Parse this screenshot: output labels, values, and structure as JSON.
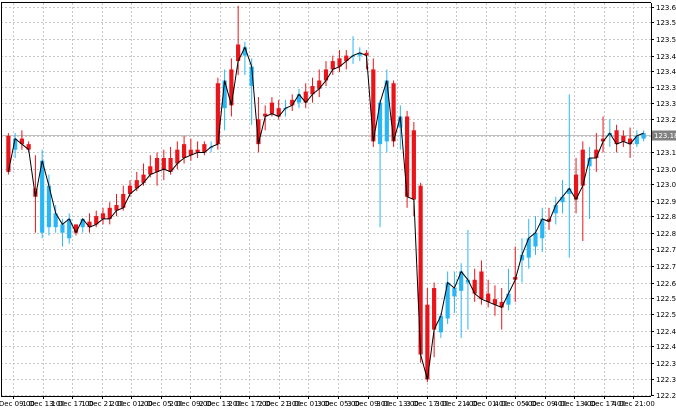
{
  "chart_data": {
    "type": "candlestick",
    "title": "",
    "xlabel": "",
    "ylabel": "",
    "y_range": [
      122.24,
      123.66
    ],
    "grid": true,
    "up_color": "#29b6f6",
    "down_color": "#e8151b",
    "line_color": "#000000",
    "axis_color": "#000000",
    "grid_color": "#c8c8c8",
    "price_line_color": "#c0c0c0",
    "last_label_bg": "#808080",
    "y_ticks": [
      "123.645",
      "123.590",
      "123.530",
      "123.470",
      "123.415",
      "123.355",
      "123.300",
      "123.240",
      "123.180",
      "123.120",
      "123.060",
      "123.005",
      "122.945",
      "122.890",
      "122.830",
      "122.770",
      "122.710",
      "122.650",
      "122.595",
      "122.535",
      "122.475",
      "122.420",
      "122.360",
      "122.300",
      "122.245"
    ],
    "x_ticks": [
      "1 Dec 09:00",
      "1 Dec 13:00",
      "1 Dec 17:00",
      "1 Dec 21:00",
      "2 Dec 01:00",
      "2 Dec 05:00",
      "2 Dec 09:00",
      "2 Dec 13:00",
      "2 Dec 17:00",
      "2 Dec 21:00",
      "3 Dec 01:00",
      "3 Dec 05:00",
      "3 Dec 09:00",
      "3 Dec 13:00",
      "3 Dec 17:00",
      "3 Dec 21:00",
      "4 Dec 01:00",
      "4 Dec 05:00",
      "4 Dec 09:00",
      "4 Dec 13:00",
      "4 Dec 17:00",
      "4 Dec 21:00"
    ],
    "last_price": "123.184",
    "last_price_value": 123.184,
    "ohlc": [
      {
        "o": 123.18,
        "h": 123.19,
        "l": 123.04,
        "c": 123.05
      },
      {
        "o": 123.13,
        "h": 123.19,
        "l": 123.1,
        "c": 123.17
      },
      {
        "o": 123.17,
        "h": 123.2,
        "l": 123.13,
        "c": 123.15
      },
      {
        "o": 123.15,
        "h": 123.16,
        "l": 123.12,
        "c": 123.13
      },
      {
        "o": 122.99,
        "h": 123.11,
        "l": 122.83,
        "c": 122.96
      },
      {
        "o": 122.83,
        "h": 123.13,
        "l": 122.81,
        "c": 123.09
      },
      {
        "o": 122.85,
        "h": 123.04,
        "l": 122.82,
        "c": 123.0
      },
      {
        "o": 122.85,
        "h": 122.93,
        "l": 122.83,
        "c": 122.9
      },
      {
        "o": 122.83,
        "h": 122.88,
        "l": 122.78,
        "c": 122.86
      },
      {
        "o": 122.81,
        "h": 122.9,
        "l": 122.79,
        "c": 122.88
      },
      {
        "o": 122.86,
        "h": 122.86,
        "l": 122.82,
        "c": 122.83
      },
      {
        "o": 122.85,
        "h": 122.88,
        "l": 122.83,
        "c": 122.88
      },
      {
        "o": 122.87,
        "h": 122.9,
        "l": 122.83,
        "c": 122.85
      },
      {
        "o": 122.89,
        "h": 122.91,
        "l": 122.85,
        "c": 122.86
      },
      {
        "o": 122.9,
        "h": 122.92,
        "l": 122.86,
        "c": 122.88
      },
      {
        "o": 122.92,
        "h": 122.94,
        "l": 122.86,
        "c": 122.88
      },
      {
        "o": 122.93,
        "h": 122.97,
        "l": 122.89,
        "c": 122.91
      },
      {
        "o": 122.97,
        "h": 123.0,
        "l": 122.91,
        "c": 122.92
      },
      {
        "o": 123.0,
        "h": 123.02,
        "l": 122.96,
        "c": 122.97
      },
      {
        "o": 123.02,
        "h": 123.05,
        "l": 122.98,
        "c": 122.99
      },
      {
        "o": 123.04,
        "h": 123.08,
        "l": 123.0,
        "c": 123.01
      },
      {
        "o": 123.07,
        "h": 123.11,
        "l": 123.03,
        "c": 123.04
      },
      {
        "o": 123.1,
        "h": 123.12,
        "l": 123.0,
        "c": 123.05
      },
      {
        "o": 123.1,
        "h": 123.13,
        "l": 123.02,
        "c": 123.06
      },
      {
        "o": 123.1,
        "h": 123.14,
        "l": 123.04,
        "c": 123.05
      },
      {
        "o": 123.13,
        "h": 123.16,
        "l": 123.06,
        "c": 123.08
      },
      {
        "o": 123.15,
        "h": 123.18,
        "l": 123.08,
        "c": 123.1
      },
      {
        "o": 123.13,
        "h": 123.17,
        "l": 123.09,
        "c": 123.11
      },
      {
        "o": 123.13,
        "h": 123.16,
        "l": 123.1,
        "c": 123.12
      },
      {
        "o": 123.15,
        "h": 123.16,
        "l": 123.11,
        "c": 123.12
      },
      {
        "o": 123.14,
        "h": 123.16,
        "l": 123.12,
        "c": 123.14
      },
      {
        "o": 123.37,
        "h": 123.39,
        "l": 123.13,
        "c": 123.15
      },
      {
        "o": 123.28,
        "h": 123.42,
        "l": 123.2,
        "c": 123.38
      },
      {
        "o": 123.42,
        "h": 123.46,
        "l": 123.25,
        "c": 123.29
      },
      {
        "o": 123.51,
        "h": 123.65,
        "l": 123.4,
        "c": 123.45
      },
      {
        "o": 123.47,
        "h": 123.52,
        "l": 123.4,
        "c": 123.5
      },
      {
        "o": 123.36,
        "h": 123.46,
        "l": 123.22,
        "c": 123.43
      },
      {
        "o": 123.24,
        "h": 123.32,
        "l": 123.12,
        "c": 123.15
      },
      {
        "o": 123.26,
        "h": 123.29,
        "l": 123.2,
        "c": 123.25
      },
      {
        "o": 123.3,
        "h": 123.32,
        "l": 123.25,
        "c": 123.26
      },
      {
        "o": 123.28,
        "h": 123.31,
        "l": 123.24,
        "c": 123.25
      },
      {
        "o": 123.28,
        "h": 123.31,
        "l": 123.25,
        "c": 123.28
      },
      {
        "o": 123.31,
        "h": 123.33,
        "l": 123.27,
        "c": 123.29
      },
      {
        "o": 123.3,
        "h": 123.35,
        "l": 123.28,
        "c": 123.33
      },
      {
        "o": 123.34,
        "h": 123.37,
        "l": 123.28,
        "c": 123.3
      },
      {
        "o": 123.36,
        "h": 123.39,
        "l": 123.3,
        "c": 123.33
      },
      {
        "o": 123.38,
        "h": 123.42,
        "l": 123.32,
        "c": 123.35
      },
      {
        "o": 123.42,
        "h": 123.45,
        "l": 123.36,
        "c": 123.38
      },
      {
        "o": 123.45,
        "h": 123.47,
        "l": 123.4,
        "c": 123.42
      },
      {
        "o": 123.46,
        "h": 123.49,
        "l": 123.41,
        "c": 123.43
      },
      {
        "o": 123.47,
        "h": 123.49,
        "l": 123.42,
        "c": 123.45
      },
      {
        "o": 123.47,
        "h": 123.54,
        "l": 123.44,
        "c": 123.47
      },
      {
        "o": 123.47,
        "h": 123.5,
        "l": 123.45,
        "c": 123.48
      },
      {
        "o": 123.48,
        "h": 123.49,
        "l": 123.42,
        "c": 123.47
      },
      {
        "o": 123.42,
        "h": 123.46,
        "l": 123.14,
        "c": 123.16
      },
      {
        "o": 123.15,
        "h": 123.31,
        "l": 122.85,
        "c": 123.3
      },
      {
        "o": 123.16,
        "h": 123.42,
        "l": 123.12,
        "c": 123.38
      },
      {
        "o": 123.37,
        "h": 123.38,
        "l": 123.14,
        "c": 123.16
      },
      {
        "o": 123.21,
        "h": 123.29,
        "l": 123.13,
        "c": 123.25
      },
      {
        "o": 123.25,
        "h": 123.27,
        "l": 122.92,
        "c": 122.96
      },
      {
        "o": 123.2,
        "h": 123.23,
        "l": 122.89,
        "c": 122.95
      },
      {
        "o": 123.0,
        "h": 123.01,
        "l": 122.36,
        "c": 122.39
      },
      {
        "o": 122.57,
        "h": 122.63,
        "l": 122.29,
        "c": 122.3
      },
      {
        "o": 122.63,
        "h": 122.65,
        "l": 122.38,
        "c": 122.48
      },
      {
        "o": 122.47,
        "h": 122.54,
        "l": 122.45,
        "c": 122.53
      },
      {
        "o": 122.52,
        "h": 122.69,
        "l": 122.5,
        "c": 122.65
      },
      {
        "o": 122.6,
        "h": 122.69,
        "l": 122.54,
        "c": 122.63
      },
      {
        "o": 122.62,
        "h": 122.72,
        "l": 122.45,
        "c": 122.69
      },
      {
        "o": 122.65,
        "h": 122.84,
        "l": 122.48,
        "c": 122.66
      },
      {
        "o": 122.66,
        "h": 122.7,
        "l": 122.58,
        "c": 122.61
      },
      {
        "o": 122.69,
        "h": 122.73,
        "l": 122.57,
        "c": 122.59
      },
      {
        "o": 122.61,
        "h": 122.66,
        "l": 122.56,
        "c": 122.58
      },
      {
        "o": 122.59,
        "h": 122.64,
        "l": 122.53,
        "c": 122.57
      },
      {
        "o": 122.58,
        "h": 122.63,
        "l": 122.48,
        "c": 122.56
      },
      {
        "o": 122.57,
        "h": 122.7,
        "l": 122.55,
        "c": 122.61
      },
      {
        "o": 122.67,
        "h": 122.78,
        "l": 122.58,
        "c": 122.66
      },
      {
        "o": 122.73,
        "h": 122.81,
        "l": 122.65,
        "c": 122.75
      },
      {
        "o": 122.74,
        "h": 122.88,
        "l": 122.7,
        "c": 122.81
      },
      {
        "o": 122.78,
        "h": 122.89,
        "l": 122.75,
        "c": 122.83
      },
      {
        "o": 122.81,
        "h": 122.92,
        "l": 122.76,
        "c": 122.88
      },
      {
        "o": 122.88,
        "h": 122.92,
        "l": 122.84,
        "c": 122.87
      },
      {
        "o": 122.9,
        "h": 122.96,
        "l": 122.86,
        "c": 122.93
      },
      {
        "o": 122.94,
        "h": 123.02,
        "l": 122.9,
        "c": 122.96
      },
      {
        "o": 122.97,
        "h": 123.33,
        "l": 122.74,
        "c": 122.99
      },
      {
        "o": 123.04,
        "h": 123.1,
        "l": 122.9,
        "c": 122.95
      },
      {
        "o": 123.13,
        "h": 123.16,
        "l": 122.8,
        "c": 123.0
      },
      {
        "o": 123.07,
        "h": 123.14,
        "l": 122.88,
        "c": 123.1
      },
      {
        "o": 123.13,
        "h": 123.19,
        "l": 123.05,
        "c": 123.1
      },
      {
        "o": 123.17,
        "h": 123.25,
        "l": 123.12,
        "c": 123.16
      },
      {
        "o": 123.18,
        "h": 123.24,
        "l": 123.14,
        "c": 123.19
      },
      {
        "o": 123.2,
        "h": 123.22,
        "l": 123.12,
        "c": 123.15
      },
      {
        "o": 123.18,
        "h": 123.2,
        "l": 123.14,
        "c": 123.16
      },
      {
        "o": 123.17,
        "h": 123.21,
        "l": 123.1,
        "c": 123.15
      },
      {
        "o": 123.15,
        "h": 123.2,
        "l": 123.14,
        "c": 123.18
      },
      {
        "o": 123.17,
        "h": 123.2,
        "l": 123.16,
        "c": 123.19
      }
    ]
  }
}
